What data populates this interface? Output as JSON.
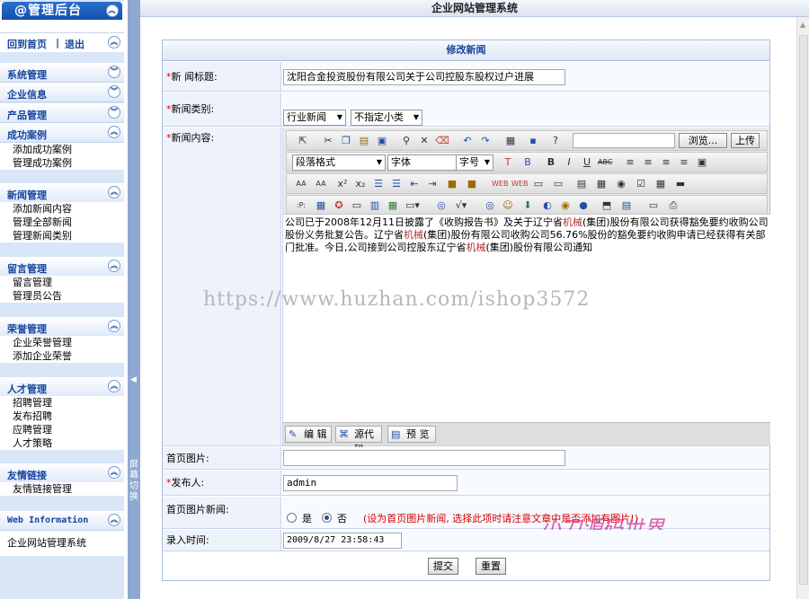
{
  "window": {
    "title": "企业网站管理系统"
  },
  "sidebar": {
    "header": "@管理后台",
    "home": "回到首页",
    "logout": "退出",
    "sections": [
      {
        "title": "系统管理",
        "items": []
      },
      {
        "title": "企业信息",
        "items": []
      },
      {
        "title": "产品管理",
        "items": []
      },
      {
        "title": "成功案例",
        "items": [
          "添加成功案例",
          "管理成功案例"
        ]
      },
      {
        "title": "新闻管理",
        "items": [
          "添加新闻内容",
          "管理全部新闻",
          "管理新闻类别"
        ]
      },
      {
        "title": "留言管理",
        "items": [
          "留言管理",
          "管理员公告"
        ]
      },
      {
        "title": "荣誉管理",
        "items": [
          "企业荣誉管理",
          "添加企业荣誉"
        ]
      },
      {
        "title": "人才管理",
        "items": [
          "招聘管理",
          "发布招聘",
          "应聘管理",
          "人才策略"
        ]
      },
      {
        "title": "友情链接",
        "items": [
          "友情链接管理"
        ]
      },
      {
        "title": "Web Information",
        "items": [
          "企业网站管理系统"
        ]
      }
    ]
  },
  "divider": {
    "label": "屏幕切换"
  },
  "form": {
    "heading": "修改新闻",
    "title_label": "新 闻标题:",
    "title_value": "沈阳合金投资股份有限公司关于公司控股东股权过户进展",
    "category_label": "新闻类别:",
    "category_value": "行业新闻",
    "subcategory_value": "不指定小类",
    "content_label": "新闻内容:",
    "editor": {
      "paragraph_select": "段落格式",
      "font_select": "字体",
      "size_select": "字号",
      "browse_button": "浏览...",
      "upload_button": "上传",
      "content": {
        "part1": "公司已于2008年12月11日披露了《收购报告书》及关于辽宁省",
        "hl1": "机械",
        "part2": "(集团)股份有限公司获得豁免要约收购公司股份义务批复公告。辽宁省",
        "hl2": "机械",
        "part3": "(集团)股份有限公司收购公司56.76%股份的豁免要约收购申请已经获得有关部门批准。今日,公司接到公司控股东辽宁省",
        "hl3": "机械",
        "part4": "(集团)股份有限公司通知"
      },
      "watermark": "https://www.huzhan.com/ishop3572",
      "modes": [
        "编  辑",
        "源代码",
        "预  览"
      ]
    },
    "image_label": "首页图片:",
    "image_value": "",
    "publisher_label": "发布人:",
    "publisher_value": "admin",
    "home_news_label": "首页图片新闻:",
    "home_news_yes": "是",
    "home_news_no": "否",
    "home_news_selected": "否",
    "home_news_note": "(设为首页图片新闻, 选择此项时请注意文章中是否添加有图片!)",
    "brand_mark": "小刀源码世界",
    "time_label": "录入时间:",
    "time_value": "2009/8/27 23:58:43",
    "submit_label": "提交",
    "reset_label": "重置"
  }
}
